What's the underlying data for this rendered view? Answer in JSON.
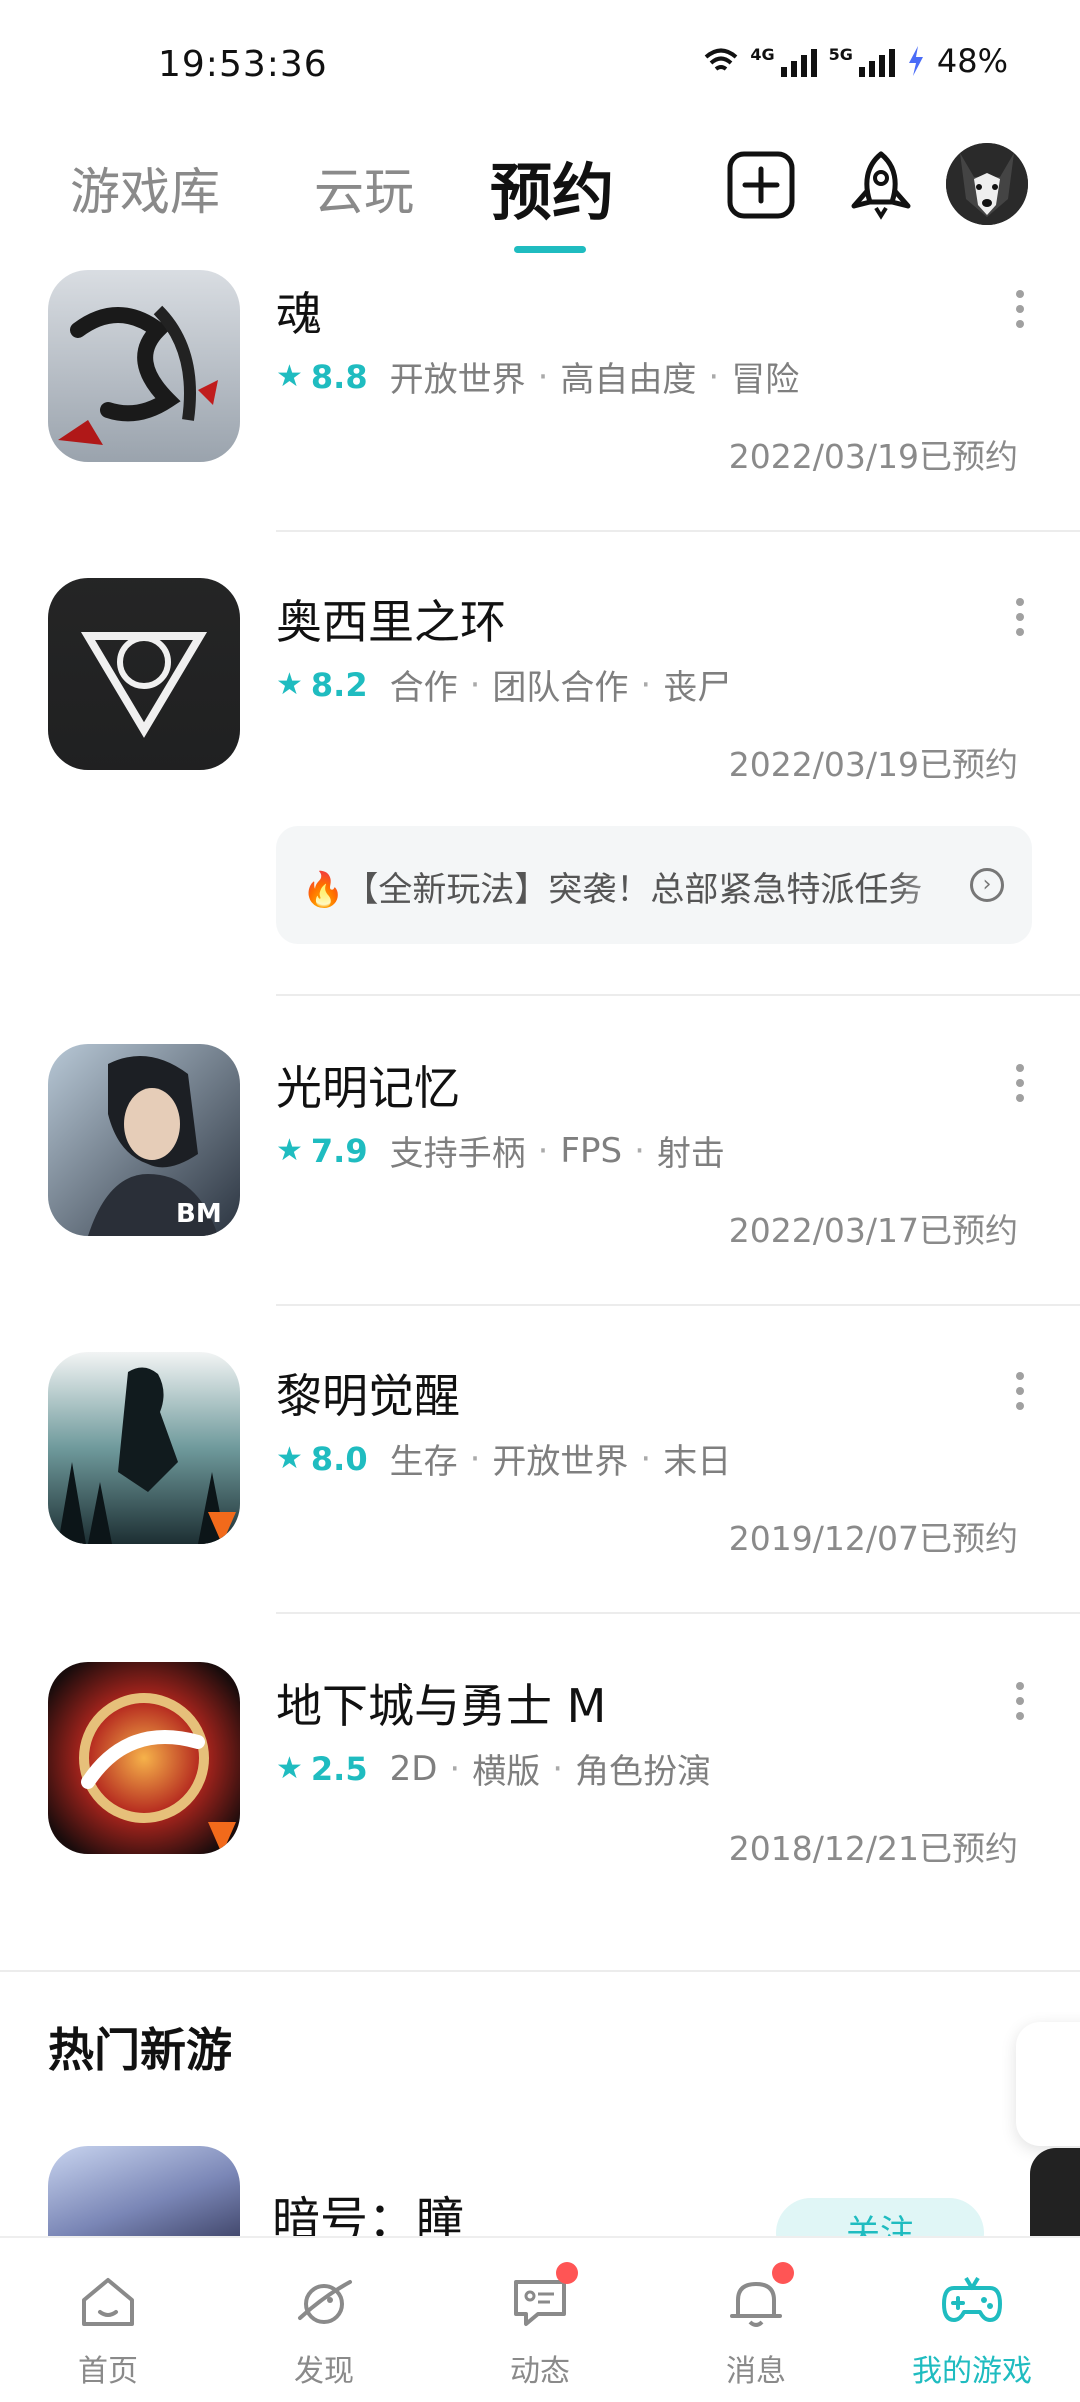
{
  "status_bar": {
    "time": "19:53:36",
    "battery": "48%",
    "net1": "4G",
    "net2": "5G"
  },
  "tabs": [
    {
      "label": "游戏库"
    },
    {
      "label": "云玩"
    },
    {
      "label": "预约"
    }
  ],
  "games": [
    {
      "name": "魂",
      "rating": "8.8",
      "tags": [
        "开放世界",
        "高自由度",
        "冒险"
      ],
      "date": "2022/03/19已预约"
    },
    {
      "name": "奥西里之环",
      "rating": "8.2",
      "tags": [
        "合作",
        "团队合作",
        "丧尸"
      ],
      "date": "2022/03/19已预约"
    },
    {
      "name": "光明记忆",
      "rating": "7.9",
      "tags": [
        "支持手柄",
        "FPS",
        "射击"
      ],
      "date": "2022/03/17已预约"
    },
    {
      "name": "黎明觉醒",
      "rating": "8.0",
      "tags": [
        "生存",
        "开放世界",
        "末日"
      ],
      "date": "2019/12/07已预约"
    },
    {
      "name": "地下城与勇士 M",
      "rating": "2.5",
      "tags": [
        "2D",
        "横版",
        "角色扮演"
      ],
      "date": "2018/12/21已预约"
    }
  ],
  "banner": {
    "text": "🔥【全新玩法】突袭！总部紧急特派任务"
  },
  "hot": {
    "title": "热门新游",
    "first_name": "暗号：瞳",
    "follow_label": "关注"
  },
  "nav": [
    {
      "label": "首页"
    },
    {
      "label": "发现"
    },
    {
      "label": "动态"
    },
    {
      "label": "消息"
    },
    {
      "label": "我的游戏"
    }
  ],
  "colors": {
    "accent": "#1fbcc0",
    "badge": "#ff5555"
  }
}
